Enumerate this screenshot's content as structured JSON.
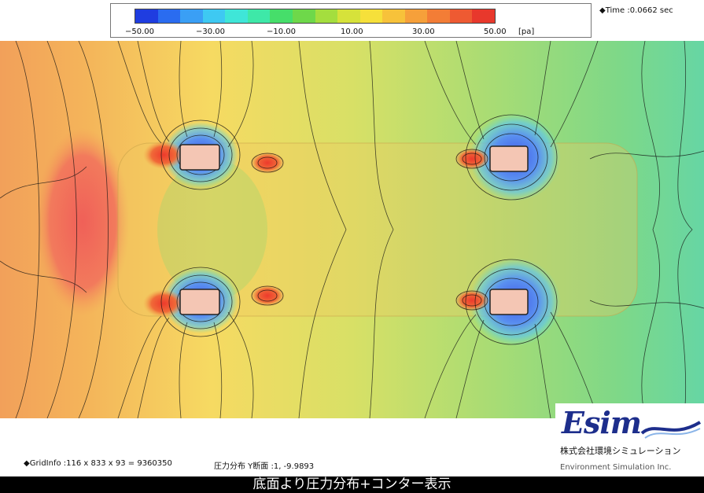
{
  "legend": {
    "colors": [
      "#1f3de0",
      "#2a6cf0",
      "#3a9ff5",
      "#3ec9f2",
      "#3fe6d8",
      "#3ee8a8",
      "#46de6a",
      "#6ed84a",
      "#a4de3e",
      "#d6e23a",
      "#f6e03a",
      "#f7c23a",
      "#f6a03a",
      "#f37d36",
      "#ee5a32",
      "#e8382c"
    ],
    "tick_labels": [
      "−50.00",
      "−30.00",
      "−10.00",
      "10.00",
      "30.00",
      "50.00"
    ],
    "unit": "[pa]"
  },
  "time_label": "◆Time :0.0662  sec",
  "grid_info": "◆GridInfo :116 x 833 x 93 = 9360350",
  "section_label": "圧力分布 Y断面 :1,  -9.9893",
  "logo": {
    "word": "Esim",
    "japanese": "株式会社環境シミュレーション",
    "english": "Environment Simulation Inc."
  },
  "subtitle": "底面より圧力分布+コンター表示"
}
